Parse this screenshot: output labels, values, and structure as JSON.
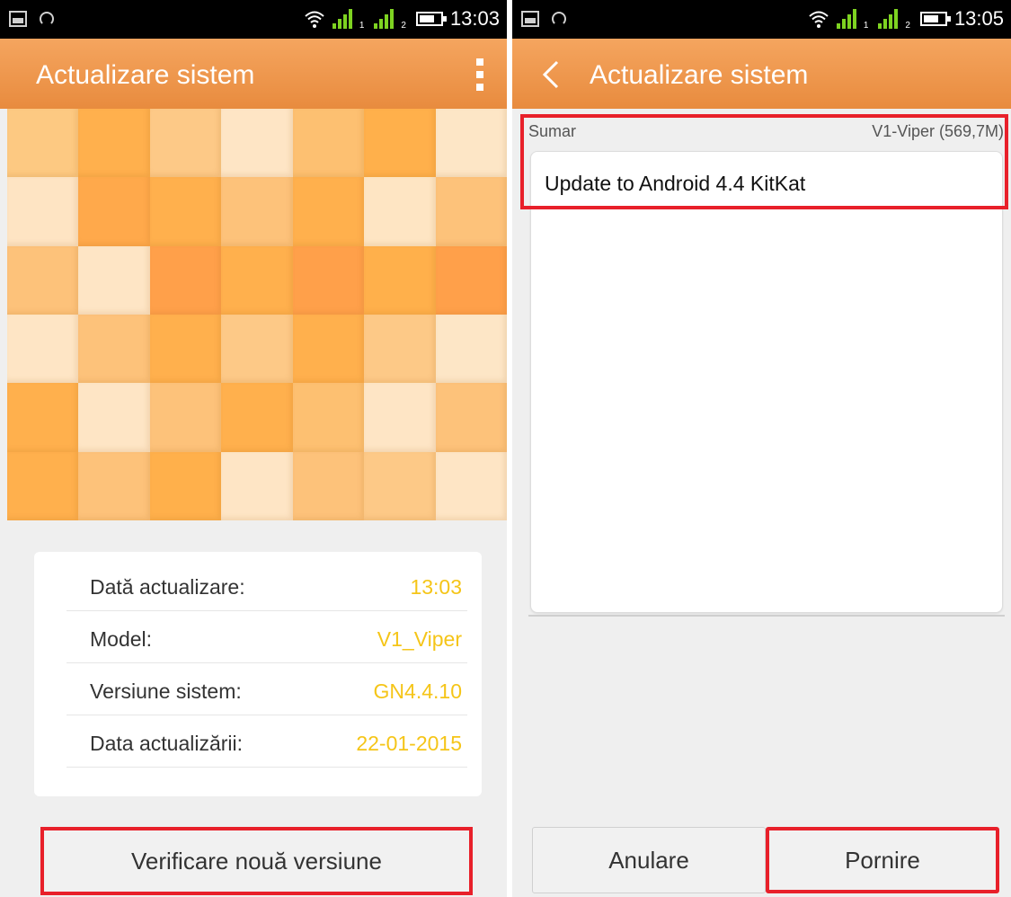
{
  "left": {
    "status": {
      "time": "13:03",
      "sim1": "1",
      "sim2": "2"
    },
    "title": "Actualizare sistem",
    "info": [
      {
        "label": "Dată actualizare:",
        "value": "13:03"
      },
      {
        "label": "Model:",
        "value": "V1_Viper"
      },
      {
        "label": "Versiune sistem:",
        "value": "GN4.4.10"
      },
      {
        "label": "Data actualizării:",
        "value": "22-01-2015"
      }
    ],
    "check_button": "Verificare nouă versiune"
  },
  "right": {
    "status": {
      "time": "13:05",
      "sim1": "1",
      "sim2": "2"
    },
    "title": "Actualizare sistem",
    "summary_label": "Sumar",
    "version": "V1-Viper (569,7M)",
    "notes": "Update to Android 4.4 KitKat",
    "cancel_button": "Anulare",
    "start_button": "Pornire"
  },
  "colors": {
    "accent": "#E88B3E",
    "value_text": "#F5C518",
    "highlight": "#E8202A",
    "signal": "#7ED321"
  },
  "icons": [
    "image-icon",
    "gauge-icon",
    "wifi-icon",
    "signal-icon",
    "battery-icon",
    "overflow-menu-icon",
    "back-icon"
  ],
  "tiles": [
    "#fdc982",
    "#ffb04d",
    "#fdc987",
    "#fee5c5",
    "#fdc071",
    "#ffb04b",
    "#fde6c6",
    "#fee4c3",
    "#ffa94b",
    "#ffb04d",
    "#fdc27a",
    "#ffb04d",
    "#fee5c3",
    "#fdc27a",
    "#fdc27a",
    "#fee5c5",
    "#ffa04a",
    "#ffb04d",
    "#ffa04a",
    "#ffb04b",
    "#ffa04a",
    "#fee5c5",
    "#fdc27a",
    "#ffb04d",
    "#fdc987",
    "#ffb04d",
    "#fdc987",
    "#fde6c6",
    "#ffb04d",
    "#fee5c5",
    "#fdc27a",
    "#ffb04d",
    "#fdc071",
    "#fee5c5",
    "#fdc27a",
    "#ffb04d",
    "#fdc27a",
    "#ffb04b",
    "#fee5c5",
    "#fdc27a",
    "#fdc987",
    "#fee5c5"
  ]
}
